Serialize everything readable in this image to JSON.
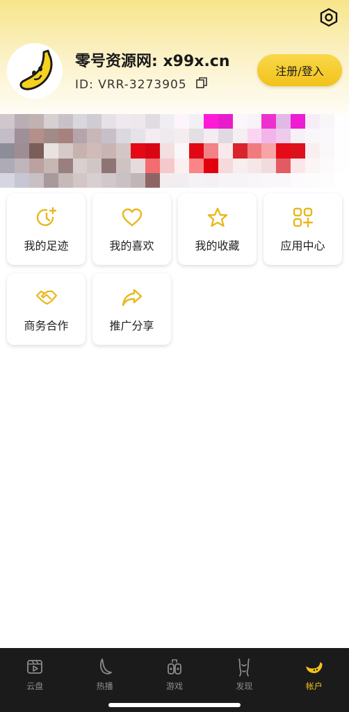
{
  "header": {
    "site_title": "零号资源网: x99x.cn",
    "user_id": "ID: VRR-3273905",
    "login_button": "注册/登入",
    "settings_icon": "hexagon-gear-icon",
    "avatar_icon": "banana-icon",
    "copy_icon": "copy-icon"
  },
  "banner": {
    "note": "",
    "pixels": [
      [
        "#cfc7cc",
        "#b9aeb4",
        "#c0b1b3",
        "#d7cfd2",
        "#c8c2c8",
        "#d9d6dc",
        "#cfccd3",
        "#e5e1e6",
        "#efe9ee",
        "#eee8ec",
        "#e1dce2",
        "#efeef3",
        "#fdf5fb",
        "#f2f0f4",
        "#ff1ad8",
        "#e81ccd",
        "#fbf6fa",
        "#f8f3f8",
        "#ee30cf",
        "#e2b8e6",
        "#ee1cd2",
        "#f5eef6",
        "#f9f6fa",
        "#fefefe"
      ],
      [
        "#c4bcc7",
        "#9e8f98",
        "#b58f8a",
        "#a18b87",
        "#a6817e",
        "#b5a4a9",
        "#c8b6b8",
        "#c7c0c8",
        "#dbd8df",
        "#e6e3e8",
        "#f3ecf0",
        "#efeaee",
        "#f4edef",
        "#e4dfe4",
        "#f3edf2",
        "#e0d9e0",
        "#f3eff3",
        "#fbd4f2",
        "#f1b5ea",
        "#eecaec",
        "#f6f1f5",
        "#f9f6fa",
        "#fbf8fb",
        "#fefefe"
      ],
      [
        "#8d8d98",
        "#9e8d92",
        "#7b5d5a",
        "#e9e2df",
        "#d6cac8",
        "#c7b2ad",
        "#d0bbb9",
        "#c9b4b4",
        "#d4c6c6",
        "#e50915",
        "#d80613",
        "#f3dfe0",
        "#f9f7f9",
        "#e20714",
        "#f08288",
        "#f9e9eb",
        "#d9242c",
        "#f07b7f",
        "#f7a4a6",
        "#e50b17",
        "#dc131c",
        "#f8eff0",
        "#fbf8fa",
        "#fefefe"
      ],
      [
        "#aeabb6",
        "#c0b5ba",
        "#bba19f",
        "#c6b6b4",
        "#997f7e",
        "#d8cfce",
        "#d1c6c6",
        "#8f7476",
        "#cec2c3",
        "#e6dbdc",
        "#f26c70",
        "#f5c9cb",
        "#fbeff0",
        "#f98588",
        "#e2000e",
        "#f5dadc",
        "#f8eef0",
        "#f5e6e8",
        "#f2dbdd",
        "#e45a63",
        "#fbe7e9",
        "#fcf5f6",
        "#fdfafb",
        "#fefefe"
      ],
      [
        "#d6d6e3",
        "#c7c6d3",
        "#c8c0c2",
        "#a89a9b",
        "#c5b9b9",
        "#d2c6c6",
        "#d7cfd0",
        "#d0c8ca",
        "#c9c1c4",
        "#c0b6b8",
        "#8e6565",
        "#f3edef",
        "#f2edf0",
        "#f5f2f5",
        "#f4f0f3",
        "#f6f4f7",
        "#f7f4f7",
        "#f8f6f8",
        "#f9f7f9",
        "#f9f7f9",
        "#fcfafc",
        "#fdfcfd",
        "#fefdfe",
        "#ffffff"
      ]
    ]
  },
  "grid_items": [
    {
      "label": "我的足迹",
      "icon": "history-clock-icon"
    },
    {
      "label": "我的喜欢",
      "icon": "heart-icon"
    },
    {
      "label": "我的收藏",
      "icon": "star-icon"
    },
    {
      "label": "应用中心",
      "icon": "app-grid-plus-icon"
    },
    {
      "label": "商务合作",
      "icon": "handshake-icon"
    },
    {
      "label": "推广分享",
      "icon": "share-arrow-icon"
    }
  ],
  "tabs": [
    {
      "label": "云盘",
      "icon": "play-box-icon"
    },
    {
      "label": "热播",
      "icon": "flame-leaf-icon"
    },
    {
      "label": "游戏",
      "icon": "game-controller-icon"
    },
    {
      "label": "发现",
      "icon": "figure-icon"
    },
    {
      "label": "帐户",
      "icon": "banana-account-icon",
      "active": true
    }
  ],
  "colors": {
    "accent": "#f2c21a",
    "tabbar_bg": "#1b1b1b",
    "header_gradient_top": "#f7e58a"
  }
}
